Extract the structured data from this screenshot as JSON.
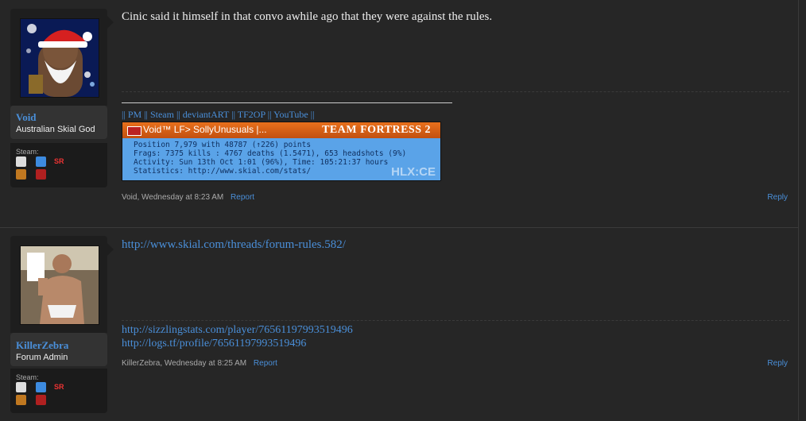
{
  "posts": [
    {
      "username": "Void",
      "usertitle": "Australian Skial God",
      "extra_label": "Steam:",
      "message": "Cinic said it himself in that convo awhile ago that they were against the rules.",
      "signature": {
        "links": [
          "PM",
          "Steam",
          "deviantART",
          "TF2OP",
          "YouTube"
        ],
        "separator": "||",
        "banner": {
          "name": "Void™ LF> SollyUnusuals |...",
          "logo": "TEAM FORTRESS 2",
          "line1": "Position 7,979 with 48787 (↑226) points",
          "line2": "Frags: 7375 kills : 4767 deaths (1.5471), 653 headshots (9%)",
          "line3": "Activity: Sun 13th Oct 1:01 (96%), Time: 105:21:37 hours",
          "line4": "Statistics: http://www.skial.com/stats/",
          "watermark": "HLX:CE"
        }
      },
      "meta_author": "Void",
      "meta_time": "Wednesday at 8:23 AM",
      "report": "Report",
      "reply": "Reply"
    },
    {
      "username": "KillerZebra",
      "usertitle": "Forum Admin",
      "extra_label": "Steam:",
      "message_link": "http://www.skial.com/threads/forum-rules.582/",
      "signature": {
        "link1": "http://sizzlingstats.com/player/76561197993519496",
        "link2": "http://logs.tf/profile/76561197993519496"
      },
      "meta_author": "KillerZebra",
      "meta_time": "Wednesday at 8:25 AM",
      "report": "Report",
      "reply": "Reply"
    }
  ]
}
